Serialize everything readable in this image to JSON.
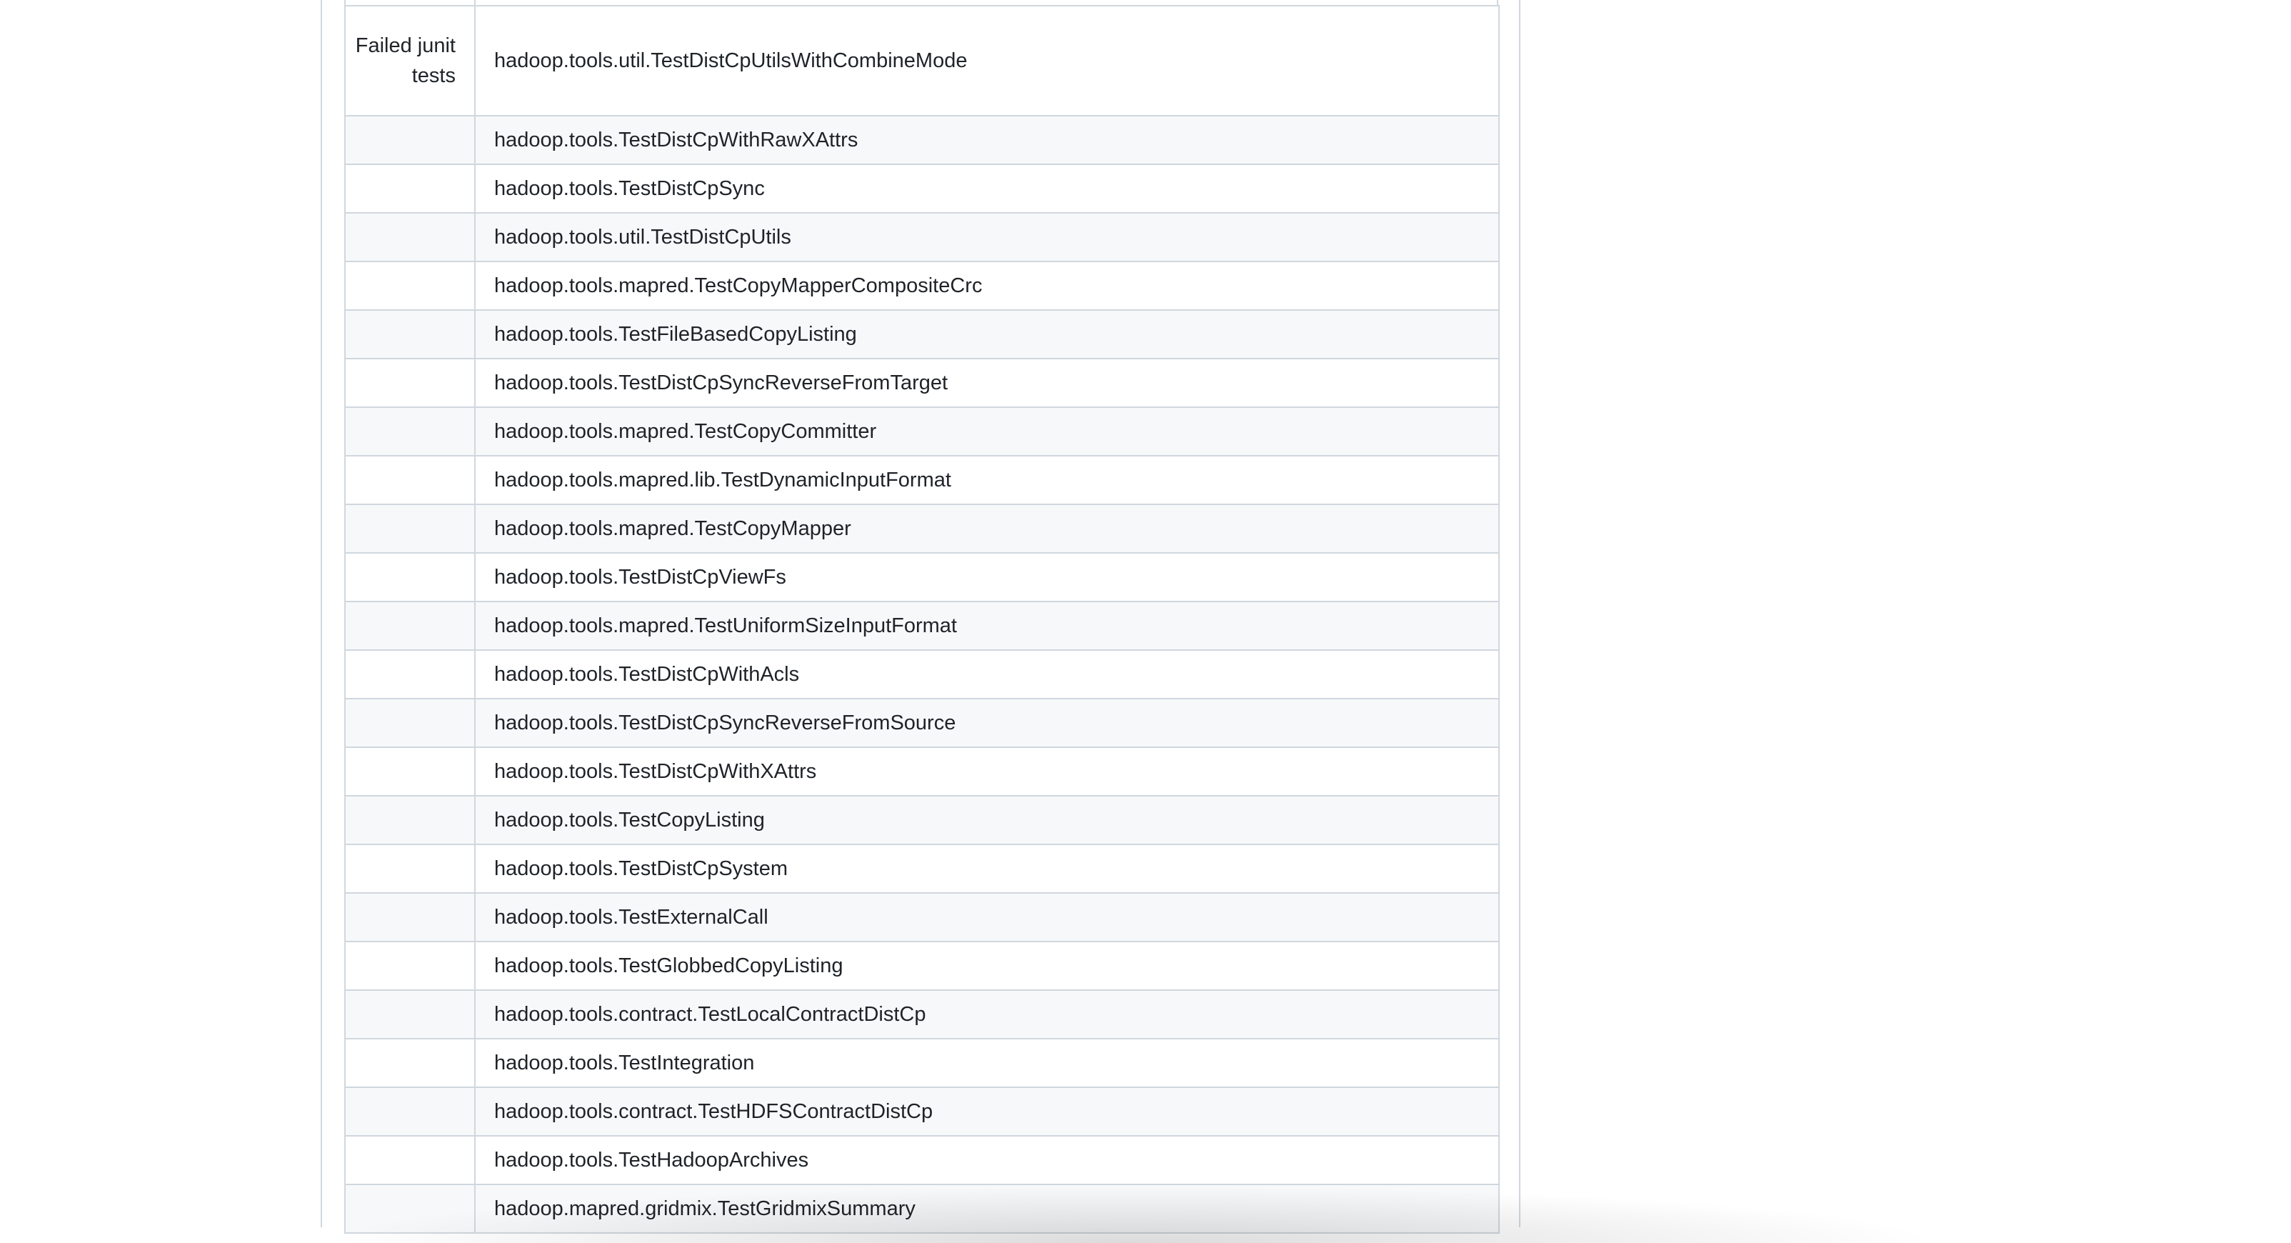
{
  "tests_table": {
    "first_row": {
      "label": "Failed junit tests",
      "test": "hadoop.tools.util.TestDistCpUtilsWithCombineMode"
    },
    "rows": [
      "hadoop.tools.TestDistCpWithRawXAttrs",
      "hadoop.tools.TestDistCpSync",
      "hadoop.tools.util.TestDistCpUtils",
      "hadoop.tools.mapred.TestCopyMapperCompositeCrc",
      "hadoop.tools.TestFileBasedCopyListing",
      "hadoop.tools.TestDistCpSyncReverseFromTarget",
      "hadoop.tools.mapred.TestCopyCommitter",
      "hadoop.tools.mapred.lib.TestDynamicInputFormat",
      "hadoop.tools.mapred.TestCopyMapper",
      "hadoop.tools.TestDistCpViewFs",
      "hadoop.tools.mapred.TestUniformSizeInputFormat",
      "hadoop.tools.TestDistCpWithAcls",
      "hadoop.tools.TestDistCpSyncReverseFromSource",
      "hadoop.tools.TestDistCpWithXAttrs",
      "hadoop.tools.TestCopyListing",
      "hadoop.tools.TestDistCpSystem",
      "hadoop.tools.TestExternalCall",
      "hadoop.tools.TestGlobbedCopyListing",
      "hadoop.tools.contract.TestLocalContractDistCp",
      "hadoop.tools.TestIntegration",
      "hadoop.tools.contract.TestHDFSContractDistCp",
      "hadoop.tools.TestHadoopArchives",
      "hadoop.mapred.gridmix.TestGridmixSummary"
    ]
  }
}
